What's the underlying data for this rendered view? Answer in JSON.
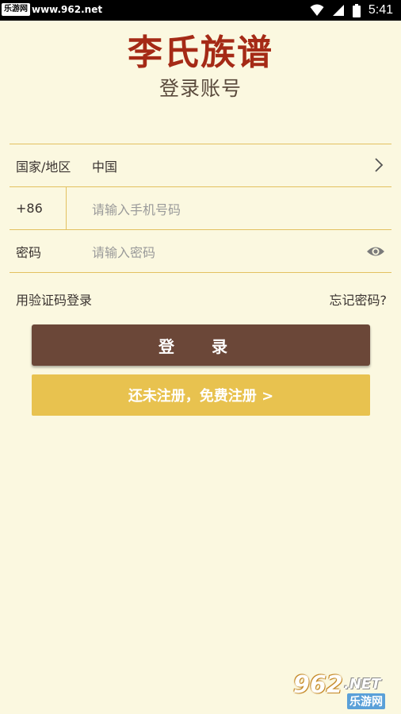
{
  "status_bar": {
    "site_badge": "乐游网",
    "site_url": "www.962.net",
    "time": "5:41"
  },
  "header": {
    "app_title": "李氏族谱",
    "subtitle": "登录账号"
  },
  "form": {
    "country_label": "国家/地区",
    "country_value": "中国",
    "phone_prefix": "+86",
    "phone_placeholder": "请输入手机号码",
    "password_label": "密码",
    "password_placeholder": "请输入密码"
  },
  "links": {
    "sms_login": "用验证码登录",
    "forgot_password": "忘记密码?"
  },
  "buttons": {
    "login": "登 录",
    "register": "还未注册，免费注册 >"
  },
  "watermark": {
    "number": "962",
    "tld": ".NET",
    "cn_name": "乐游网"
  },
  "icons": {
    "wifi": "wifi-icon",
    "signal": "signal-icon",
    "battery": "battery-icon",
    "chevron": "chevron-right-icon",
    "eye": "eye-icon"
  },
  "colors": {
    "background": "#fbf8e0",
    "title_red": "#a52a16",
    "divider_gold": "#e3c160",
    "login_brown": "#6b4738",
    "register_gold": "#e8c24f"
  }
}
